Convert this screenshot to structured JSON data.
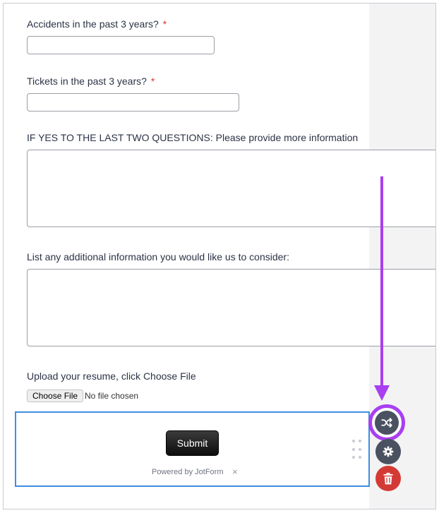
{
  "fields": {
    "accidents": {
      "label": "Accidents in the past 3 years?",
      "required_marker": "*",
      "value": "",
      "placeholder": ""
    },
    "tickets": {
      "label": "Tickets in the past 3 years?",
      "required_marker": "*",
      "value": "",
      "placeholder": ""
    },
    "more_info": {
      "label": "IF YES TO THE LAST TWO QUESTIONS: Please provide more information",
      "value": ""
    },
    "additional_info": {
      "label": "List any additional information you would like us to consider:",
      "value": ""
    },
    "upload": {
      "label": "Upload your resume, click Choose File",
      "button_label": "Choose File",
      "status": "No file chosen"
    }
  },
  "submit_section": {
    "submit_label": "Submit",
    "powered_by": "Powered by JotForm",
    "close_label": "×"
  },
  "toolbar": {
    "shuffle_icon": "shuffle-icon",
    "gear_icon": "gear-icon",
    "trash_icon": "trash-icon"
  },
  "colors": {
    "highlight": "#a93ff0",
    "selection_border": "#3f8ee0",
    "required": "#e0332f",
    "delete": "#d43a35",
    "tool_button": "#4a5160"
  }
}
